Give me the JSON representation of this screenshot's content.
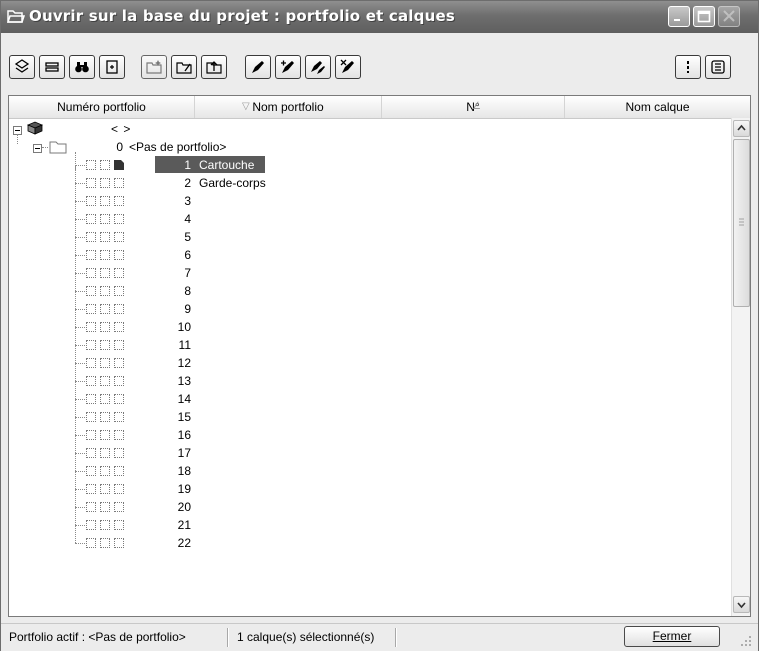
{
  "window": {
    "title": "Ouvrir sur la base du projet : portfolio et calques"
  },
  "header": {
    "col1": "Numéro portfolio",
    "col2": "Nom portfolio",
    "col3": "N°",
    "col4": "Nom calque",
    "sort2": "▽",
    "sort3": "∠"
  },
  "tree": {
    "root_nav": "<   >",
    "folder_num": "0",
    "folder_label": "<Pas de portfolio>",
    "layers": [
      {
        "num": "1",
        "name": "Cartouche"
      },
      {
        "num": "2",
        "name": "Garde-corps"
      },
      {
        "num": "3",
        "name": ""
      },
      {
        "num": "4",
        "name": ""
      },
      {
        "num": "5",
        "name": ""
      },
      {
        "num": "6",
        "name": ""
      },
      {
        "num": "7",
        "name": ""
      },
      {
        "num": "8",
        "name": ""
      },
      {
        "num": "9",
        "name": ""
      },
      {
        "num": "10",
        "name": ""
      },
      {
        "num": "11",
        "name": ""
      },
      {
        "num": "12",
        "name": ""
      },
      {
        "num": "13",
        "name": ""
      },
      {
        "num": "14",
        "name": ""
      },
      {
        "num": "15",
        "name": ""
      },
      {
        "num": "16",
        "name": ""
      },
      {
        "num": "17",
        "name": ""
      },
      {
        "num": "18",
        "name": ""
      },
      {
        "num": "19",
        "name": ""
      },
      {
        "num": "20",
        "name": ""
      },
      {
        "num": "21",
        "name": ""
      },
      {
        "num": "22",
        "name": ""
      }
    ]
  },
  "status": {
    "active_portfolio": "Portfolio actif : <Pas de portfolio>",
    "selection": "1 calque(s) sélectionné(s)",
    "close_label": "Fermer"
  }
}
